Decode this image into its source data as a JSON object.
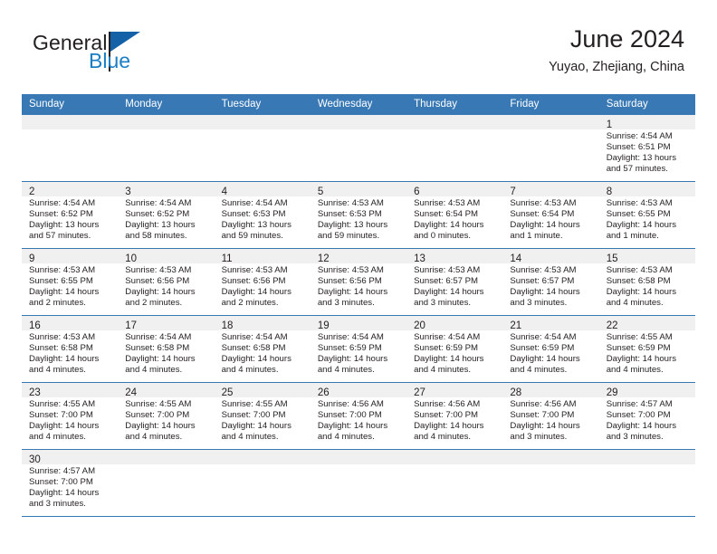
{
  "brand": {
    "name_part1": "General",
    "name_part2": "Blue",
    "logo_icon": "flag-triangle-icon",
    "accent_color": "#1c7fc4",
    "flag_color": "#1461a8"
  },
  "header": {
    "title": "June 2024",
    "subtitle": "Yuyao, Zhejiang, China"
  },
  "calendar": {
    "header_bg_color": "#3878b4",
    "grid_line_color": "#3878b4",
    "date_band_color": "#f0f0f0",
    "weekday_headers": [
      "Sunday",
      "Monday",
      "Tuesday",
      "Wednesday",
      "Thursday",
      "Friday",
      "Saturday"
    ],
    "weeks": [
      [
        {
          "day": "",
          "sunrise": "",
          "sunset": "",
          "daylight": "",
          "empty": true
        },
        {
          "day": "",
          "sunrise": "",
          "sunset": "",
          "daylight": "",
          "empty": true
        },
        {
          "day": "",
          "sunrise": "",
          "sunset": "",
          "daylight": "",
          "empty": true
        },
        {
          "day": "",
          "sunrise": "",
          "sunset": "",
          "daylight": "",
          "empty": true
        },
        {
          "day": "",
          "sunrise": "",
          "sunset": "",
          "daylight": "",
          "empty": true
        },
        {
          "day": "",
          "sunrise": "",
          "sunset": "",
          "daylight": "",
          "empty": true
        },
        {
          "day": "1",
          "sunrise": "Sunrise: 4:54 AM",
          "sunset": "Sunset: 6:51 PM",
          "daylight": "Daylight: 13 hours and 57 minutes.",
          "empty": false
        }
      ],
      [
        {
          "day": "2",
          "sunrise": "Sunrise: 4:54 AM",
          "sunset": "Sunset: 6:52 PM",
          "daylight": "Daylight: 13 hours and 57 minutes.",
          "empty": false
        },
        {
          "day": "3",
          "sunrise": "Sunrise: 4:54 AM",
          "sunset": "Sunset: 6:52 PM",
          "daylight": "Daylight: 13 hours and 58 minutes.",
          "empty": false
        },
        {
          "day": "4",
          "sunrise": "Sunrise: 4:54 AM",
          "sunset": "Sunset: 6:53 PM",
          "daylight": "Daylight: 13 hours and 59 minutes.",
          "empty": false
        },
        {
          "day": "5",
          "sunrise": "Sunrise: 4:53 AM",
          "sunset": "Sunset: 6:53 PM",
          "daylight": "Daylight: 13 hours and 59 minutes.",
          "empty": false
        },
        {
          "day": "6",
          "sunrise": "Sunrise: 4:53 AM",
          "sunset": "Sunset: 6:54 PM",
          "daylight": "Daylight: 14 hours and 0 minutes.",
          "empty": false
        },
        {
          "day": "7",
          "sunrise": "Sunrise: 4:53 AM",
          "sunset": "Sunset: 6:54 PM",
          "daylight": "Daylight: 14 hours and 1 minute.",
          "empty": false
        },
        {
          "day": "8",
          "sunrise": "Sunrise: 4:53 AM",
          "sunset": "Sunset: 6:55 PM",
          "daylight": "Daylight: 14 hours and 1 minute.",
          "empty": false
        }
      ],
      [
        {
          "day": "9",
          "sunrise": "Sunrise: 4:53 AM",
          "sunset": "Sunset: 6:55 PM",
          "daylight": "Daylight: 14 hours and 2 minutes.",
          "empty": false
        },
        {
          "day": "10",
          "sunrise": "Sunrise: 4:53 AM",
          "sunset": "Sunset: 6:56 PM",
          "daylight": "Daylight: 14 hours and 2 minutes.",
          "empty": false
        },
        {
          "day": "11",
          "sunrise": "Sunrise: 4:53 AM",
          "sunset": "Sunset: 6:56 PM",
          "daylight": "Daylight: 14 hours and 2 minutes.",
          "empty": false
        },
        {
          "day": "12",
          "sunrise": "Sunrise: 4:53 AM",
          "sunset": "Sunset: 6:56 PM",
          "daylight": "Daylight: 14 hours and 3 minutes.",
          "empty": false
        },
        {
          "day": "13",
          "sunrise": "Sunrise: 4:53 AM",
          "sunset": "Sunset: 6:57 PM",
          "daylight": "Daylight: 14 hours and 3 minutes.",
          "empty": false
        },
        {
          "day": "14",
          "sunrise": "Sunrise: 4:53 AM",
          "sunset": "Sunset: 6:57 PM",
          "daylight": "Daylight: 14 hours and 3 minutes.",
          "empty": false
        },
        {
          "day": "15",
          "sunrise": "Sunrise: 4:53 AM",
          "sunset": "Sunset: 6:58 PM",
          "daylight": "Daylight: 14 hours and 4 minutes.",
          "empty": false
        }
      ],
      [
        {
          "day": "16",
          "sunrise": "Sunrise: 4:53 AM",
          "sunset": "Sunset: 6:58 PM",
          "daylight": "Daylight: 14 hours and 4 minutes.",
          "empty": false
        },
        {
          "day": "17",
          "sunrise": "Sunrise: 4:54 AM",
          "sunset": "Sunset: 6:58 PM",
          "daylight": "Daylight: 14 hours and 4 minutes.",
          "empty": false
        },
        {
          "day": "18",
          "sunrise": "Sunrise: 4:54 AM",
          "sunset": "Sunset: 6:58 PM",
          "daylight": "Daylight: 14 hours and 4 minutes.",
          "empty": false
        },
        {
          "day": "19",
          "sunrise": "Sunrise: 4:54 AM",
          "sunset": "Sunset: 6:59 PM",
          "daylight": "Daylight: 14 hours and 4 minutes.",
          "empty": false
        },
        {
          "day": "20",
          "sunrise": "Sunrise: 4:54 AM",
          "sunset": "Sunset: 6:59 PM",
          "daylight": "Daylight: 14 hours and 4 minutes.",
          "empty": false
        },
        {
          "day": "21",
          "sunrise": "Sunrise: 4:54 AM",
          "sunset": "Sunset: 6:59 PM",
          "daylight": "Daylight: 14 hours and 4 minutes.",
          "empty": false
        },
        {
          "day": "22",
          "sunrise": "Sunrise: 4:55 AM",
          "sunset": "Sunset: 6:59 PM",
          "daylight": "Daylight: 14 hours and 4 minutes.",
          "empty": false
        }
      ],
      [
        {
          "day": "23",
          "sunrise": "Sunrise: 4:55 AM",
          "sunset": "Sunset: 7:00 PM",
          "daylight": "Daylight: 14 hours and 4 minutes.",
          "empty": false
        },
        {
          "day": "24",
          "sunrise": "Sunrise: 4:55 AM",
          "sunset": "Sunset: 7:00 PM",
          "daylight": "Daylight: 14 hours and 4 minutes.",
          "empty": false
        },
        {
          "day": "25",
          "sunrise": "Sunrise: 4:55 AM",
          "sunset": "Sunset: 7:00 PM",
          "daylight": "Daylight: 14 hours and 4 minutes.",
          "empty": false
        },
        {
          "day": "26",
          "sunrise": "Sunrise: 4:56 AM",
          "sunset": "Sunset: 7:00 PM",
          "daylight": "Daylight: 14 hours and 4 minutes.",
          "empty": false
        },
        {
          "day": "27",
          "sunrise": "Sunrise: 4:56 AM",
          "sunset": "Sunset: 7:00 PM",
          "daylight": "Daylight: 14 hours and 4 minutes.",
          "empty": false
        },
        {
          "day": "28",
          "sunrise": "Sunrise: 4:56 AM",
          "sunset": "Sunset: 7:00 PM",
          "daylight": "Daylight: 14 hours and 3 minutes.",
          "empty": false
        },
        {
          "day": "29",
          "sunrise": "Sunrise: 4:57 AM",
          "sunset": "Sunset: 7:00 PM",
          "daylight": "Daylight: 14 hours and 3 minutes.",
          "empty": false
        }
      ],
      [
        {
          "day": "30",
          "sunrise": "Sunrise: 4:57 AM",
          "sunset": "Sunset: 7:00 PM",
          "daylight": "Daylight: 14 hours and 3 minutes.",
          "empty": false
        },
        {
          "day": "",
          "sunrise": "",
          "sunset": "",
          "daylight": "",
          "empty": true
        },
        {
          "day": "",
          "sunrise": "",
          "sunset": "",
          "daylight": "",
          "empty": true
        },
        {
          "day": "",
          "sunrise": "",
          "sunset": "",
          "daylight": "",
          "empty": true
        },
        {
          "day": "",
          "sunrise": "",
          "sunset": "",
          "daylight": "",
          "empty": true
        },
        {
          "day": "",
          "sunrise": "",
          "sunset": "",
          "daylight": "",
          "empty": true
        },
        {
          "day": "",
          "sunrise": "",
          "sunset": "",
          "daylight": "",
          "empty": true
        }
      ]
    ]
  }
}
